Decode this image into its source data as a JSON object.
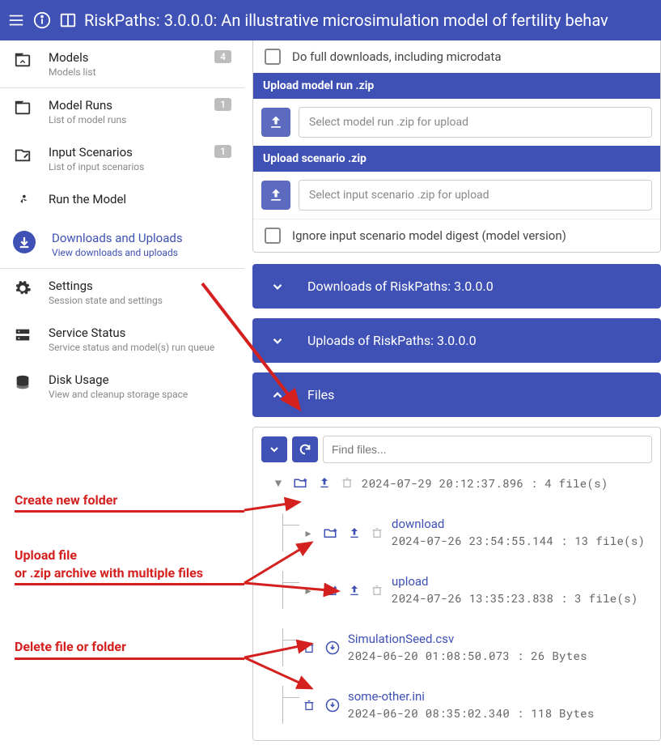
{
  "header": {
    "title": "RiskPaths: 3.0.0.0: An illustrative microsimulation model of fertility behav"
  },
  "sidebar": {
    "items": [
      {
        "title": "Models",
        "sub": "Models list",
        "badge": "4"
      },
      {
        "title": "Model Runs",
        "sub": "List of model runs",
        "badge": "1"
      },
      {
        "title": "Input Scenarios",
        "sub": "List of input scenarios",
        "badge": "1"
      },
      {
        "title": "Run the Model",
        "sub": ""
      },
      {
        "title": "Downloads and Uploads",
        "sub": "View downloads and uploads"
      },
      {
        "title": "Settings",
        "sub": "Session state and settings"
      },
      {
        "title": "Service Status",
        "sub": "Service status and model(s) run queue"
      },
      {
        "title": "Disk Usage",
        "sub": "View and cleanup storage space"
      }
    ]
  },
  "upload_panel": {
    "full_download_label": "Do full downloads, including microdata",
    "run_head": "Upload model run .zip",
    "run_placeholder": "Select model run .zip for upload",
    "scen_head": "Upload scenario .zip",
    "scen_placeholder": "Select input scenario .zip for upload",
    "ignore_digest_label": "Ignore input scenario model digest (model version)"
  },
  "accordions": {
    "downloads": "Downloads of RiskPaths: 3.0.0.0",
    "uploads": "Uploads of RiskPaths: 3.0.0.0",
    "files": "Files"
  },
  "files_panel": {
    "find_placeholder": "Find files...",
    "root_meta": "2024-07-29 20:12:37.896 : 4 file(s)",
    "folders": [
      {
        "name": "download",
        "meta": "2024-07-26 23:54:55.144 : 13 file(s)"
      },
      {
        "name": "upload",
        "meta": "2024-07-26 13:35:23.838 : 3 file(s)"
      }
    ],
    "files": [
      {
        "name": "SimulationSeed.csv",
        "meta": "2024-06-20 01:08:50.073 : 26 Bytes"
      },
      {
        "name": "some-other.ini",
        "meta": "2024-06-20 08:35:02.340 : 118 Bytes"
      }
    ]
  },
  "annotations": {
    "create": "Create new folder",
    "upload1": "Upload file",
    "upload2": "or .zip archive with multiple files",
    "delete": "Delete file or folder"
  }
}
